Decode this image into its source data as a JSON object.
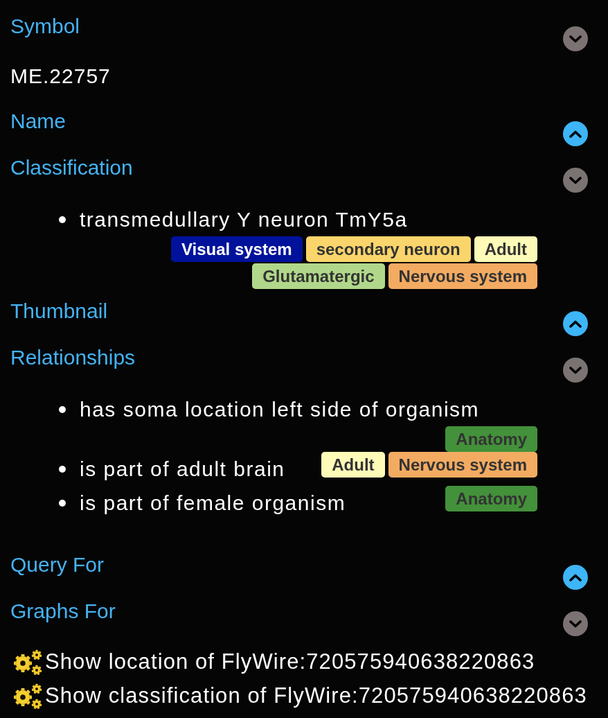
{
  "sections": [
    {
      "title": "Symbol",
      "expanded": true,
      "kind": "text",
      "text": "ME.22757"
    },
    {
      "title": "Name",
      "expanded": false
    },
    {
      "title": "Classification",
      "expanded": true,
      "kind": "list",
      "items": [
        {
          "text": "transmedullary Y neuron TmY5a",
          "tags": [
            {
              "label": "Visual system",
              "color": "#00129b"
            },
            {
              "label": "secondary neuron",
              "color": "#fad56b"
            },
            {
              "label": "Adult",
              "color": "#fefbb8"
            },
            {
              "label": "Glutamatergic",
              "color": "#b1d88a"
            },
            {
              "label": "Nervous system",
              "color": "#f3ab62"
            }
          ]
        }
      ]
    },
    {
      "title": "Thumbnail",
      "expanded": false
    },
    {
      "title": "Relationships",
      "expanded": true,
      "kind": "list",
      "items": [
        {
          "text": "has soma location left side of organism",
          "tags": [
            {
              "label": "Anatomy",
              "color": "#43913a"
            }
          ]
        },
        {
          "text": "is part of adult brain",
          "tags": [
            {
              "label": "Adult",
              "color": "#fefbb8"
            },
            {
              "label": "Nervous system",
              "color": "#f3ab62"
            }
          ]
        },
        {
          "text": "is part of female organism",
          "tags": [
            {
              "label": "Anatomy",
              "color": "#43913a"
            }
          ]
        }
      ]
    },
    {
      "title": "Query For",
      "expanded": false
    },
    {
      "title": "Graphs For",
      "expanded": true,
      "kind": "links",
      "links": [
        "Show location of FlyWire:720575940638220863",
        "Show classification of FlyWire:720575940638220863"
      ]
    }
  ]
}
